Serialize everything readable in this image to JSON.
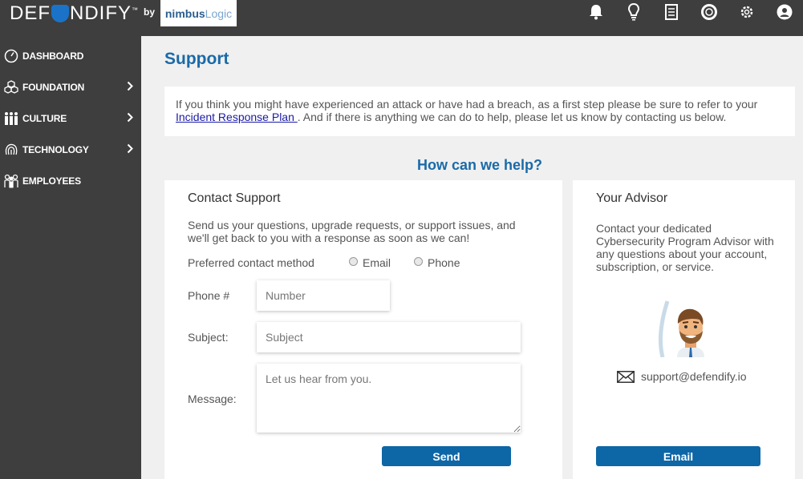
{
  "header": {
    "logo_text_left": "DEF",
    "logo_text_right": "NDIFY",
    "logo_tm": "™",
    "by": "by",
    "partner_logo_bold": "nimbus",
    "partner_logo_light": "Logic",
    "icons": [
      "bell-icon",
      "lightbulb-icon",
      "document-icon",
      "lifebuoy-icon",
      "gear-icon",
      "user-icon"
    ]
  },
  "sidebar": {
    "items": [
      {
        "label": "DASHBOARD",
        "icon": "gauge-icon",
        "chevron": false
      },
      {
        "label": "FOUNDATION",
        "icon": "cubes-icon",
        "chevron": true
      },
      {
        "label": "CULTURE",
        "icon": "people-icon",
        "chevron": true
      },
      {
        "label": "TECHNOLOGY",
        "icon": "fingerprint-icon",
        "chevron": true
      },
      {
        "label": "EMPLOYEES",
        "icon": "employees-icon",
        "chevron": false
      }
    ]
  },
  "page": {
    "title": "Support",
    "notice_before": "If you think you might have experienced an attack or have had a breach, as a first step please be sure to refer to your ",
    "notice_link": "Incident Response Plan ",
    "notice_after": ". And if there is anything we can do to help, please let us know by contacting us below.",
    "help_heading": "How can we help?"
  },
  "contact": {
    "title": "Contact Support",
    "description": "Send us your questions, upgrade requests, or support issues, and we'll get back to you with a response as soon as we can!",
    "preferred_label": "Preferred contact method",
    "option_email": "Email",
    "option_phone": "Phone",
    "phone_label": "Phone #",
    "phone_placeholder": "Number",
    "subject_label": "Subject:",
    "subject_placeholder": "Subject",
    "message_label": "Message:",
    "message_placeholder": "Let us hear from you.",
    "send_label": "Send"
  },
  "advisor": {
    "title": "Your Advisor",
    "description": "Contact your dedicated Cybersecurity Program Advisor with any questions about your account, subscription, or service.",
    "email": "support@defendify.io",
    "email_button": "Email"
  },
  "colors": {
    "accent": "#1a6aa8",
    "button": "#0d66a6",
    "sidebar": "#3e3e3e"
  }
}
